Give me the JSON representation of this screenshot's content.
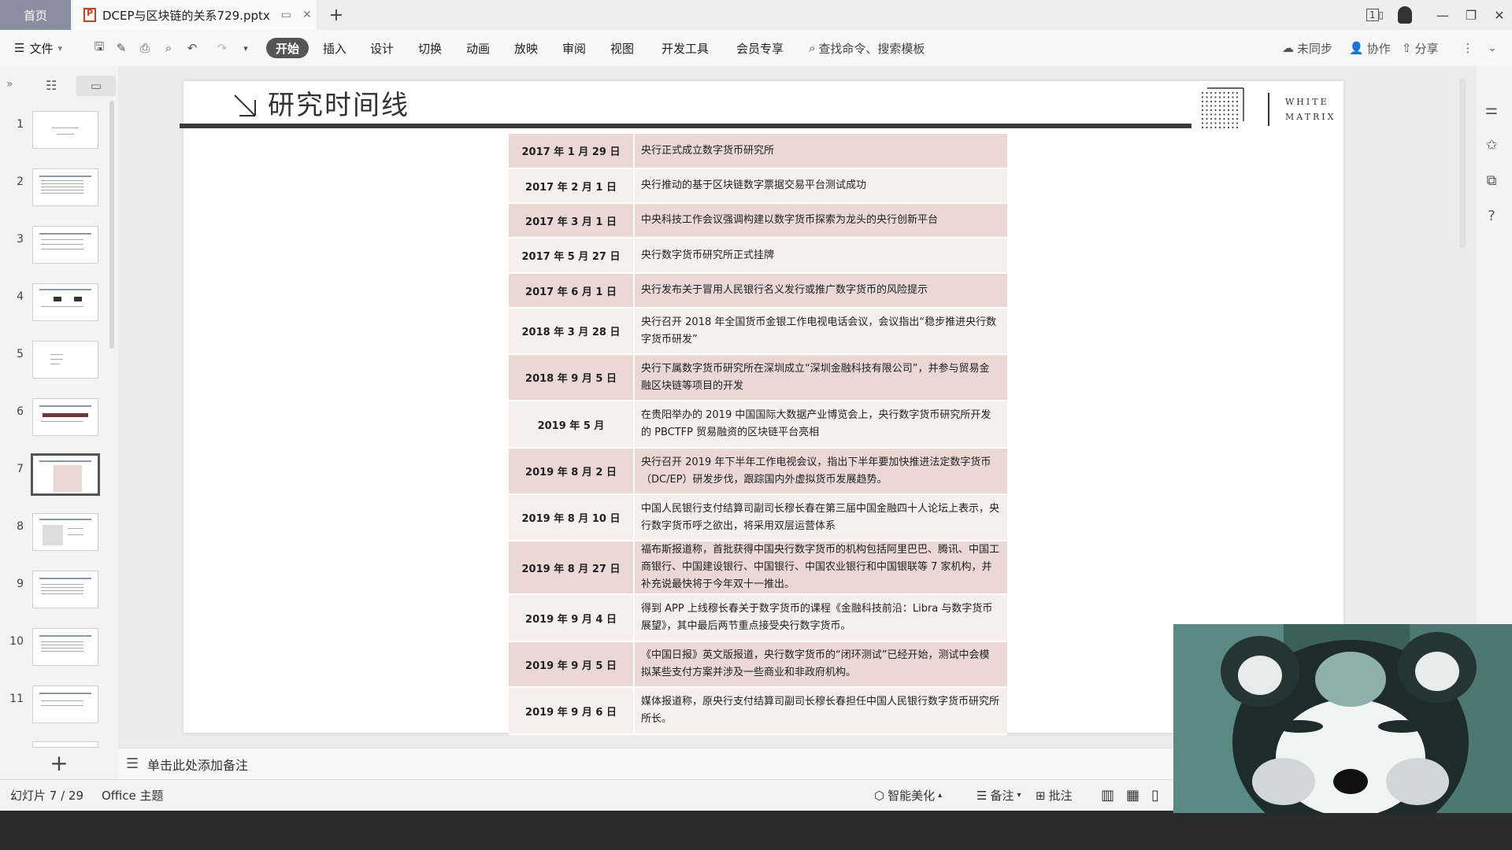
{
  "titlebar": {
    "home_tab": "首页",
    "doc_tab": "DCEP与区块链的关系729.pptx",
    "new_tab_icon": "+",
    "badge": "1"
  },
  "ribbon": {
    "file_menu": "文件",
    "tabs": [
      "开始",
      "插入",
      "设计",
      "切换",
      "动画",
      "放映",
      "审阅",
      "视图",
      "开发工具",
      "会员专享"
    ],
    "search_placeholder": "查找命令、搜索模板",
    "sync_label": "未同步",
    "collab_label": "协作",
    "share_label": "分享"
  },
  "thumbnails": {
    "numbers": [
      "1",
      "2",
      "3",
      "4",
      "5",
      "6",
      "7",
      "8",
      "9",
      "10",
      "11"
    ],
    "active": "7"
  },
  "slide": {
    "title": "研究时间线",
    "logo_line1": "WHITE",
    "logo_line2": "MATRIX",
    "rows": [
      {
        "date": "2017 年 1 月 29 日",
        "event": "央行正式成立数字货币研究所"
      },
      {
        "date": "2017 年 2 月 1 日",
        "event": "央行推动的基于区块链数字票据交易平台测试成功"
      },
      {
        "date": "2017 年 3 月 1 日",
        "event": "中央科技工作会议强调构建以数字货币探索为龙头的央行创新平台"
      },
      {
        "date": "2017 年 5 月 27 日",
        "event": "央行数字货币研究所正式挂牌"
      },
      {
        "date": "2017 年 6 月 1 日",
        "event": "央行发布关于冒用人民银行名义发行或推广数字货币的风险提示"
      },
      {
        "date": "2018 年 3 月 28 日",
        "event": "央行召开 2018 年全国货币金银工作电视电话会议，会议指出“稳步推进央行数字货币研发”"
      },
      {
        "date": "2018 年 9 月 5 日",
        "event": "央行下属数字货币研究所在深圳成立“深圳金融科技有限公司”，并参与贸易金融区块链等项目的开发"
      },
      {
        "date": "2019 年 5 月",
        "event": "在贵阳举办的 2019 中国国际大数据产业博览会上，央行数字货币研究所开发的 PBCTFP 贸易融资的区块链平台亮相"
      },
      {
        "date": "2019 年 8 月 2 日",
        "event": "央行召开 2019 年下半年工作电视会议，指出下半年要加快推进法定数字货币（DC/EP）研发步伐，跟踪国内外虚拟货币发展趋势。"
      },
      {
        "date": "2019 年 8 月 10 日",
        "event": "中国人民银行支付结算司副司长穆长春在第三届中国金融四十人论坛上表示，央行数字货币呼之欲出，将采用双层运营体系"
      },
      {
        "date": "2019 年 8 月 27 日",
        "event": "福布斯报道称，首批获得中国央行数字货币的机构包括阿里巴巴、腾讯、中国工商银行、中国建设银行、中国银行、中国农业银行和中国银联等 7 家机构，并补充说最快将于今年双十一推出。"
      },
      {
        "date": "2019 年 9 月 4 日",
        "event": "得到 APP 上线穆长春关于数字货币的课程《金融科技前沿：Libra 与数字货币展望》，其中最后两节重点接受央行数字货币。"
      },
      {
        "date": "2019 年 9 月 5 日",
        "event": "《中国日报》英文版报道，央行数字货币的“闭环测试”已经开始，测试中会模拟某些支付方案并涉及一些商业和非政府机构。"
      },
      {
        "date": "2019 年 9 月 6 日",
        "event": "媒体报道称，原央行支付结算司副司长穆长春担任中国人民银行数字货币研究所所长。"
      }
    ]
  },
  "notes": {
    "placeholder": "单击此处添加备注"
  },
  "statusbar": {
    "slide_counter": "幻灯片 7 / 29",
    "theme": "Office 主题",
    "beautify": "智能美化",
    "notes_btn": "备注",
    "comment_btn": "批注"
  },
  "colors": {
    "row_odd": "#ead8d4",
    "row_even": "#f6efed",
    "title_bar": "#3a3a3a",
    "active_tab": "#555555"
  }
}
